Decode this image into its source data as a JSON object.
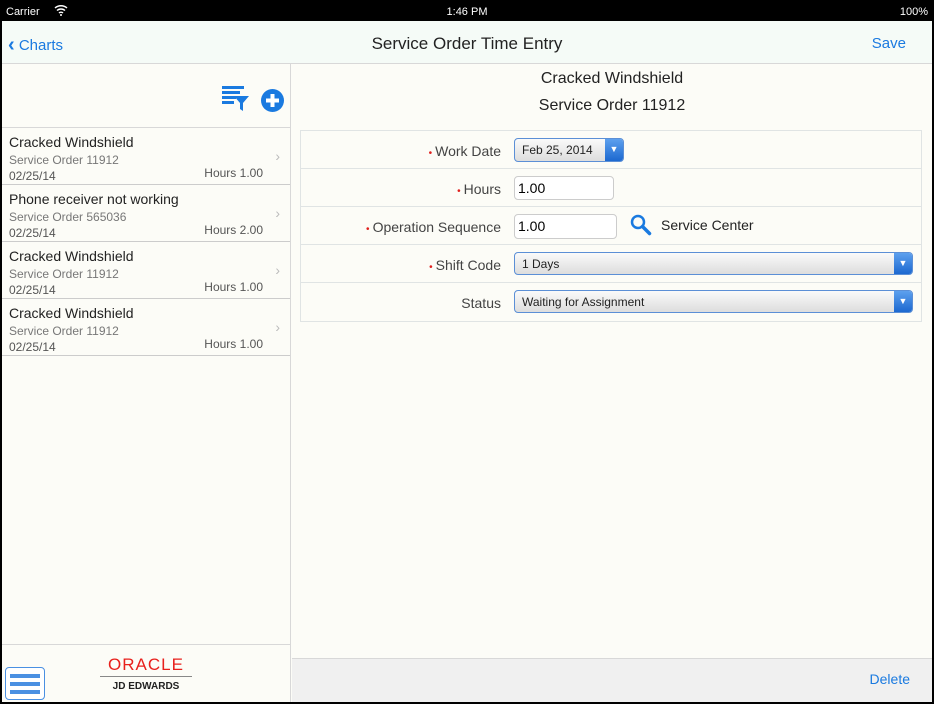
{
  "status_bar": {
    "carrier": "Carrier",
    "time": "1:46 PM",
    "battery": "100%"
  },
  "nav": {
    "back_label": "Charts",
    "title": "Service Order Time Entry",
    "save_label": "Save"
  },
  "list": [
    {
      "title": "Cracked Windshield",
      "subtitle": "Service Order 11912",
      "date": "02/25/14",
      "hours": "Hours 1.00"
    },
    {
      "title": "Phone receiver not working",
      "subtitle": "Service Order 565036",
      "date": "02/25/14",
      "hours": "Hours 2.00"
    },
    {
      "title": "Cracked Windshield",
      "subtitle": "Service Order 11912",
      "date": "02/25/14",
      "hours": "Hours 1.00"
    },
    {
      "title": "Cracked Windshield",
      "subtitle": "Service Order 11912",
      "date": "02/25/14",
      "hours": "Hours 1.00"
    }
  ],
  "logo": {
    "brand": "ORACLE",
    "product": "JD EDWARDS"
  },
  "detail": {
    "title": "Cracked Windshield",
    "subtitle": "Service Order 11912",
    "fields": {
      "work_date": {
        "label": "Work Date",
        "value": "Feb 25, 2014"
      },
      "hours": {
        "label": "Hours",
        "value": "1.00"
      },
      "operation_sequence": {
        "label": "Operation Sequence",
        "value": "1.00",
        "lookup_text": "Service Center"
      },
      "shift_code": {
        "label": "Shift Code",
        "value": "1 Days"
      },
      "status": {
        "label": "Status",
        "value": "Waiting for Assignment"
      }
    },
    "delete_label": "Delete"
  },
  "colors": {
    "accent": "#1a7ae0",
    "required": "#e0201e",
    "oracle_red": "#e8201c"
  }
}
